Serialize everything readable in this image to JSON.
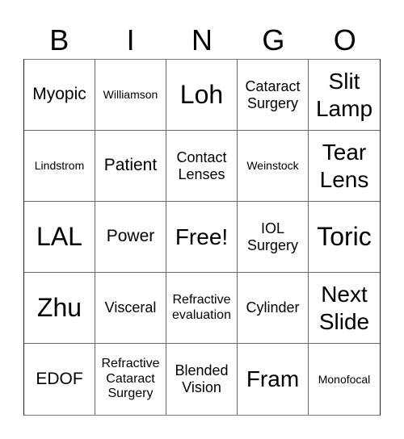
{
  "header": {
    "letters": [
      "B",
      "I",
      "N",
      "G",
      "O"
    ]
  },
  "cells": [
    "Myopic",
    "Williamson",
    "Loh",
    "Cataract Surgery",
    "Slit Lamp",
    "Lindstrom",
    "Patient",
    "Contact Lenses",
    "Weinstock",
    "Tear Lens",
    "LAL",
    "Power",
    "Free!",
    "IOL Surgery",
    "Toric",
    "Zhu",
    "Visceral",
    "Refractive evaluation",
    "Cylinder",
    "Next Slide",
    "EDOF",
    "Refractive Cataract Surgery",
    "Blended Vision",
    "Fram",
    "Monofocal"
  ]
}
